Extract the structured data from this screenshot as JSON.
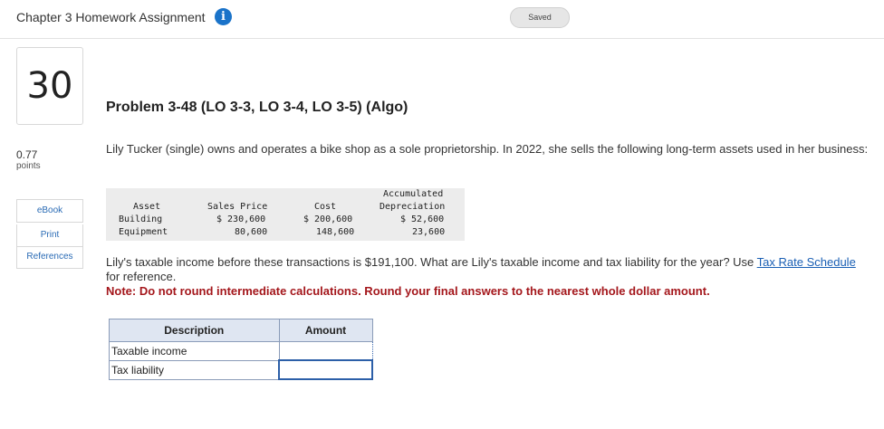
{
  "header": {
    "title": "Chapter 3 Homework Assignment",
    "saved_label": "Saved"
  },
  "sidebar": {
    "question_number": "30",
    "points_value": "0.77",
    "points_label": "points",
    "links": [
      "eBook",
      "Print",
      "References"
    ]
  },
  "problem": {
    "title": "Problem 3-48 (LO 3-3, LO 3-4, LO 3-5) (Algo)",
    "intro": "Lily Tucker (single) owns and operates a bike shop as a sole proprietorship. In 2022, she sells the following long-term assets used in her business:",
    "asset_table": {
      "headers": [
        "Asset",
        "Sales Price",
        "Cost",
        "Accumulated",
        "Depreciation"
      ],
      "rows": [
        {
          "asset": "Building",
          "sales_price": "$ 230,600",
          "cost": "$ 200,600",
          "accum_dep": "$ 52,600"
        },
        {
          "asset": "Equipment",
          "sales_price": "80,600",
          "cost": "148,600",
          "accum_dep": "23,600"
        }
      ]
    },
    "question_text": "Lily's taxable income before these transactions is $191,100. What are Lily's taxable income and tax liability for the year? Use ",
    "link_text": "Tax Rate Schedule",
    "question_tail": " for reference.",
    "note": "Note: Do not round intermediate calculations. Round your final answers to the nearest whole dollar amount."
  },
  "answer_table": {
    "headers": [
      "Description",
      "Amount"
    ],
    "rows": [
      {
        "label": "Taxable income",
        "value": ""
      },
      {
        "label": "Tax liability",
        "value": ""
      }
    ]
  }
}
